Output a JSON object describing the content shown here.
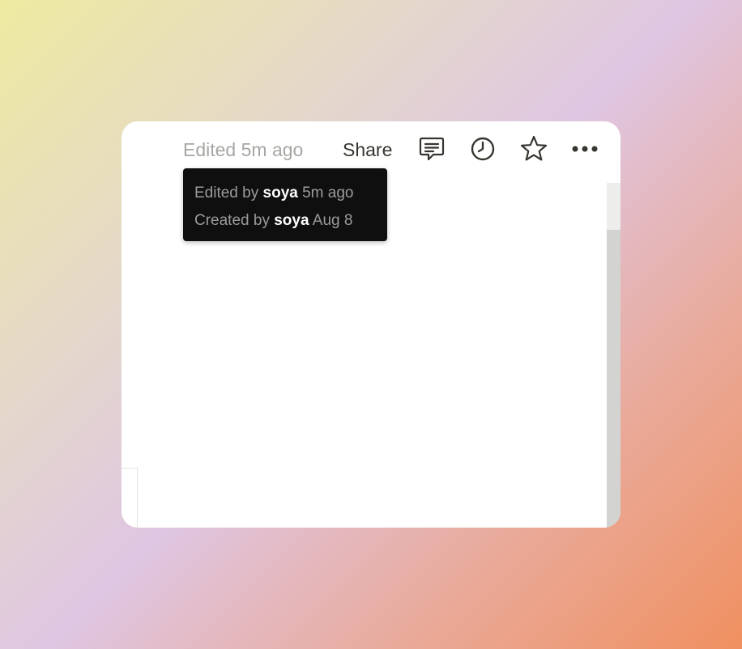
{
  "topbar": {
    "edited_label": "Edited 5m ago",
    "share_label": "Share",
    "icons": {
      "comments": "comment-icon",
      "updates": "clock-icon",
      "favorite": "star-icon",
      "more": "more-icon"
    }
  },
  "tooltip": {
    "edited_prefix": "Edited by",
    "edited_user": "soya",
    "edited_time": "5m ago",
    "created_prefix": "Created by",
    "created_user": "soya",
    "created_time": "Aug 8"
  },
  "colors": {
    "icon": "#37352f",
    "muted_text": "#a6a6a3",
    "tooltip_bg": "#0f0f0f"
  }
}
